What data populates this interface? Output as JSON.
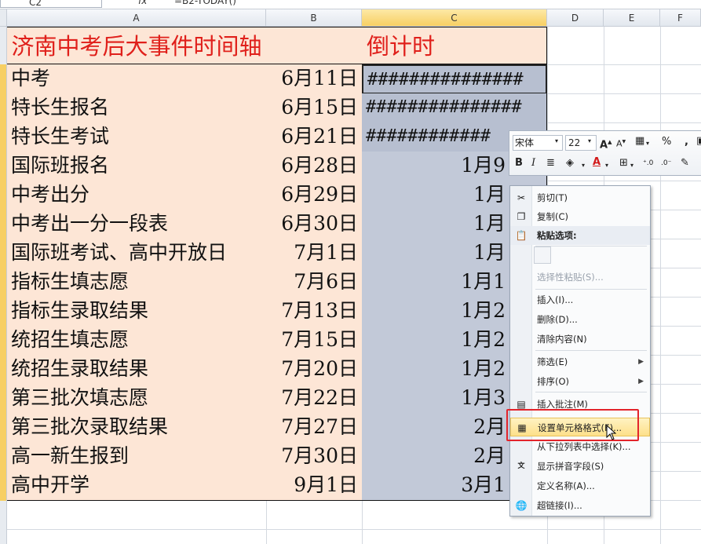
{
  "formula_bar": {
    "name_box": "C2",
    "fx": "fx",
    "formula": "=B2-TODAY()"
  },
  "columns": [
    "A",
    "B",
    "C",
    "D",
    "E",
    "F"
  ],
  "sheet": {
    "title": "济南中考后大事件时间轴",
    "countdown_header": "倒计时",
    "rows": [
      {
        "event": "中考",
        "date": "6月11日",
        "countdown": "###############"
      },
      {
        "event": "特长生报名",
        "date": "6月15日",
        "countdown": "###############"
      },
      {
        "event": "特长生考试",
        "date": "6月21日",
        "countdown": "############"
      },
      {
        "event": "国际班报名",
        "date": "6月28日",
        "countdown": "1月9"
      },
      {
        "event": "中考出分",
        "date": "6月29日",
        "countdown": "1月"
      },
      {
        "event": "中考出一分一段表",
        "date": "6月30日",
        "countdown": "1月"
      },
      {
        "event": "国际班考试、高中开放日",
        "date": "7月1日",
        "countdown": "1月"
      },
      {
        "event": "指标生填志愿",
        "date": "7月6日",
        "countdown": "1月1"
      },
      {
        "event": "指标生录取结果",
        "date": "7月13日",
        "countdown": "1月2"
      },
      {
        "event": "统招生填志愿",
        "date": "7月15日",
        "countdown": "1月2"
      },
      {
        "event": "统招生录取结果",
        "date": "7月20日",
        "countdown": "1月2"
      },
      {
        "event": "第三批次填志愿",
        "date": "7月22日",
        "countdown": "1月3"
      },
      {
        "event": "第三批次录取结果",
        "date": "7月27日",
        "countdown": "2月"
      },
      {
        "event": "高一新生报到",
        "date": "7月30日",
        "countdown": "2月"
      },
      {
        "event": "高中开学",
        "date": "9月1日",
        "countdown": "3月1"
      }
    ]
  },
  "mini_toolbar": {
    "font": "宋体",
    "size": "22",
    "percent": "%",
    "comma": ","
  },
  "context_menu": {
    "cut": "剪切(T)",
    "copy": "复制(C)",
    "paste_options": "粘贴选项:",
    "paste_special": "选择性粘贴(S)...",
    "insert": "插入(I)...",
    "delete": "删除(D)...",
    "clear": "清除内容(N)",
    "filter": "筛选(E)",
    "sort": "排序(O)",
    "insert_comment": "插入批注(M)",
    "format_cells": "设置单元格格式(F)...",
    "pick_list": "从下拉列表中选择(K)...",
    "phonetic": "显示拼音字段(S)",
    "define_name": "定义名称(A)...",
    "hyperlink": "超链接(I)..."
  }
}
